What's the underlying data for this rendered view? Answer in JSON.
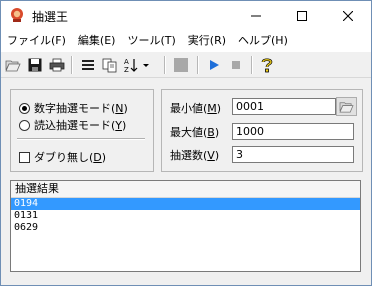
{
  "window": {
    "title": "抽選王"
  },
  "menu": [
    {
      "label": "ファイル(F)"
    },
    {
      "label": "編集(E)"
    },
    {
      "label": "ツール(T)"
    },
    {
      "label": "実行(R)"
    },
    {
      "label": "ヘルプ(H)"
    }
  ],
  "toolbar": {
    "buttons": [
      "open-folder-icon",
      "save-icon",
      "print-icon",
      "list-icon",
      "copy-icon",
      "sort-az-icon",
      "stop-square-icon",
      "play-icon",
      "stop-icon",
      "help-icon"
    ]
  },
  "mode": {
    "numeric_label": "数字抽選モード(",
    "numeric_key": "N",
    "read_label": "読込抽選モード(",
    "read_key": "Y",
    "selected": "numeric",
    "allow_dup_label": "ダブり無し(",
    "allow_dup_key": "D",
    "allow_dup_checked": false
  },
  "params": {
    "min_label": "最小値(",
    "min_key": "M",
    "min_value": "0001",
    "max_label": "最大値(",
    "max_key": "B",
    "max_value": "1000",
    "count_label": "抽選数(",
    "count_key": "V",
    "count_value": "3"
  },
  "results": {
    "header": "抽選結果",
    "rows": [
      "0194",
      "0131",
      "0629"
    ],
    "selected_index": 0
  },
  "colors": {
    "selection": "#3399ff",
    "accent": "#1e6fd9"
  }
}
